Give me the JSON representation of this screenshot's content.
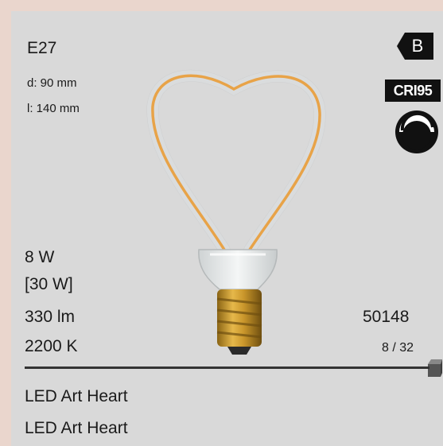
{
  "product": {
    "base": "E27",
    "diameter": "d: 90 mm",
    "length": "l:  140 mm",
    "power": "8 W",
    "equivalent_power": "[30 W]",
    "lumen": "330 lm",
    "color_temp": "2200 K",
    "article_number": "50148",
    "packaging": "8 / 32",
    "name_line_1": "LED Art Heart",
    "name_line_2": "LED Art Heart"
  },
  "badges": {
    "energy_class": "B",
    "cri": "CRI95",
    "dimmer_icon": "dimmable-icon",
    "box_icon": "box-icon"
  },
  "colors": {
    "card_bg": "#d9d9d9",
    "page_bg": "#ead6cd",
    "filament": "#e8a348",
    "base_gold": "#d9a535",
    "badge_dark": "#111111"
  }
}
